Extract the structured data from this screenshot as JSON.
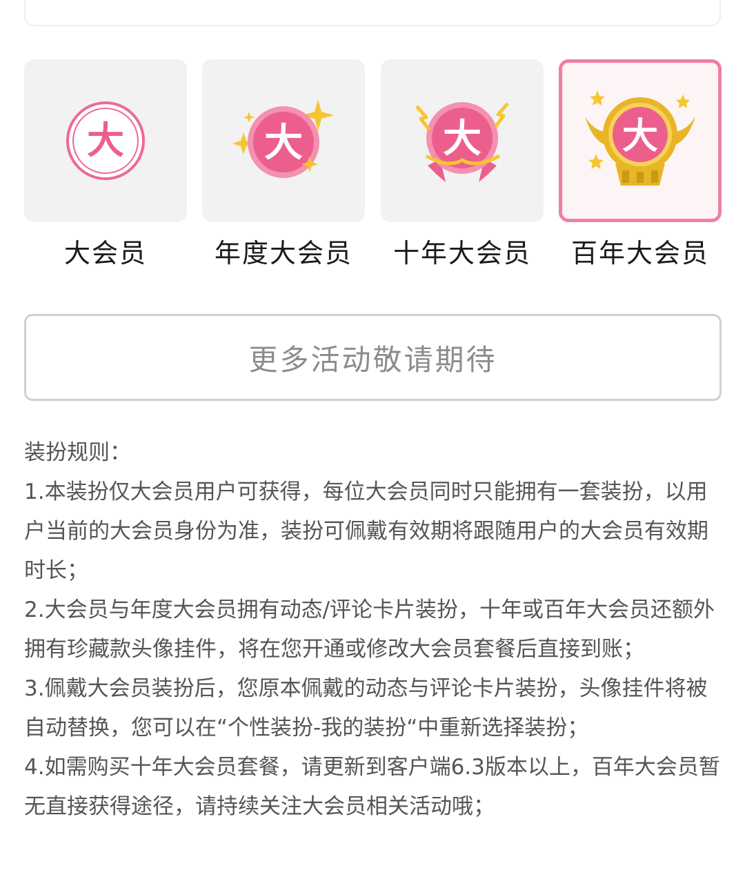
{
  "tiers": [
    {
      "label": "大会员",
      "badge_char": "大",
      "selected": false
    },
    {
      "label": "年度大会员",
      "badge_char": "大",
      "selected": false
    },
    {
      "label": "十年大会员",
      "badge_char": "大",
      "selected": false
    },
    {
      "label": "百年大会员",
      "badge_char": "大",
      "selected": true
    }
  ],
  "more_button": {
    "label": "更多活动敬请期待"
  },
  "rules": {
    "title": "装扮规则：",
    "items": [
      "1.本装扮仅大会员用户可获得，每位大会员同时只能拥有一套装扮，以用户当前的大会员身份为准，装扮可佩戴有效期将跟随用户的大会员有效期时长；",
      "2.大会员与年度大会员拥有动态/评论卡片装扮，十年或百年大会员还额外拥有珍藏款头像挂件，将在您开通或修改大会员套餐后直接到账；",
      "3.佩戴大会员装扮后，您原本佩戴的动态与评论卡片装扮，头像挂件将被自动替换，您可以在“个性装扮-我的装扮“中重新选择装扮；",
      "4.如需购买十年大会员套餐，请更新到客户端6.3版本以上，百年大会员暂无直接获得途径，请持续关注大会员相关活动哦；"
    ]
  },
  "colors": {
    "accent_pink": "#f07fa2",
    "badge_pink": "#ec5f8c",
    "gold": "#e8b526"
  }
}
